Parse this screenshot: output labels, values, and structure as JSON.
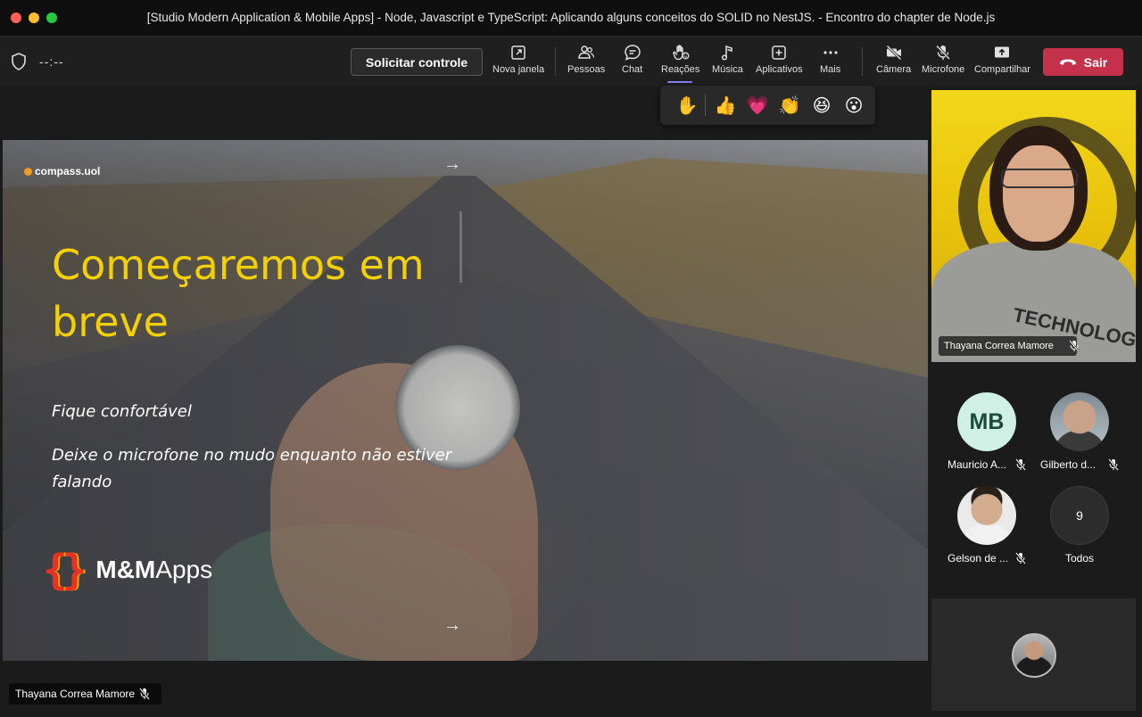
{
  "window": {
    "title": "[Studio Modern Application & Mobile Apps] - Node, Javascript e TypeScript: Aplicando alguns conceitos do SOLID no NestJS. - Encontro do chapter de Node.js"
  },
  "toolbar": {
    "timer": "--:--",
    "request_control": "Solicitar controle",
    "buttons": [
      {
        "id": "new-window",
        "label": "Nova janela",
        "icon": "popout-icon"
      },
      {
        "id": "people",
        "label": "Pessoas",
        "icon": "people-icon"
      },
      {
        "id": "chat",
        "label": "Chat",
        "icon": "chat-icon"
      },
      {
        "id": "reactions",
        "label": "Reações",
        "icon": "reaction-hand-icon"
      },
      {
        "id": "music",
        "label": "Música",
        "icon": "music-note-icon"
      },
      {
        "id": "apps",
        "label": "Aplicativos",
        "icon": "plus-box-icon"
      },
      {
        "id": "more",
        "label": "Mais",
        "icon": "more-dots-icon"
      },
      {
        "id": "camera",
        "label": "Câmera",
        "icon": "camera-off-icon"
      },
      {
        "id": "mic",
        "label": "Microfone",
        "icon": "mic-off-icon"
      },
      {
        "id": "share",
        "label": "Compartilhar",
        "icon": "share-screen-icon"
      }
    ],
    "leave": "Sair",
    "accent_color": "#7f85f5",
    "leave_color": "#c4314b"
  },
  "reactions": {
    "items": [
      "✋",
      "👍",
      "💗",
      "👏",
      "😆",
      "😮"
    ]
  },
  "slide": {
    "brand": "compass.uol",
    "title": "Começaremos em breve",
    "line1": "Fique confortável",
    "line2": "Deixe o microfone no mudo enquanto não estiver falando",
    "logo_brace": "{}",
    "logo_bold": "M&M",
    "logo_light": "Apps",
    "arrow_glyph": "→",
    "title_color": "#f5d000"
  },
  "presenter": {
    "name": "Thayana Correa Mamore"
  },
  "speaker": {
    "name": "Thayana Correa Mamore",
    "shirt_text": "TECHNOLOGY"
  },
  "participants": [
    {
      "initials": "MB",
      "name": "Mauricio A...",
      "muted": true
    },
    {
      "initials": "",
      "name": "Gilberto d...",
      "muted": true
    },
    {
      "initials": "",
      "name": "Gelson de ...",
      "muted": true
    },
    {
      "initials": "9",
      "name": "Todos",
      "muted": false
    }
  ]
}
